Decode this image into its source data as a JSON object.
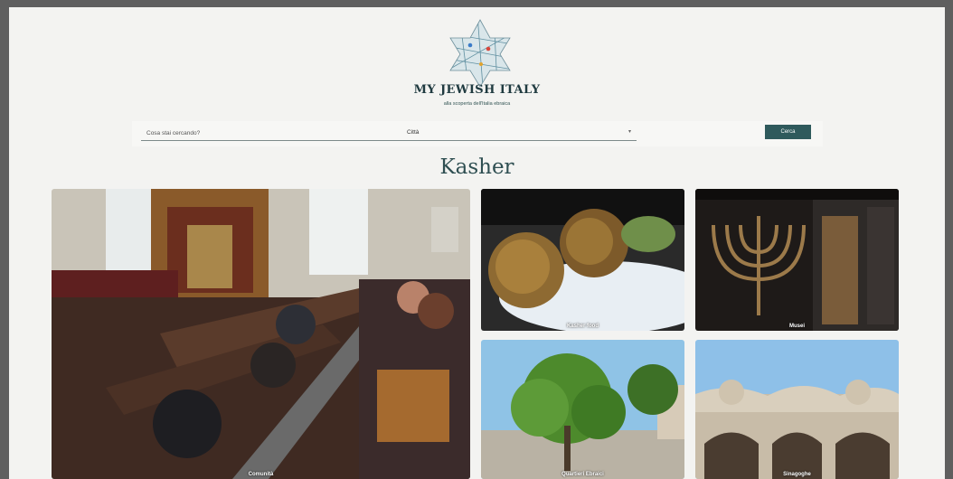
{
  "header": {
    "site_title": "MY JEWISH ITALY",
    "tagline": "alla scoperta dell'Italia ebraica",
    "logo_icon": "star-of-david-map-logo"
  },
  "search": {
    "query_placeholder": "Cosa stai cercando?",
    "query_value": "",
    "city_label": "Città",
    "button_label": "Cerca"
  },
  "page": {
    "heading": "Kasher"
  },
  "tiles": [
    {
      "label": "Comunità"
    },
    {
      "label": "Kasher food"
    },
    {
      "label": "Musei"
    },
    {
      "label": "Quartieri Ebraici"
    },
    {
      "label": "Sinagoghe"
    }
  ],
  "colors": {
    "accent": "#2f5a5c",
    "heading": "#2f4f52",
    "page_bg": "#f3f3f1"
  }
}
